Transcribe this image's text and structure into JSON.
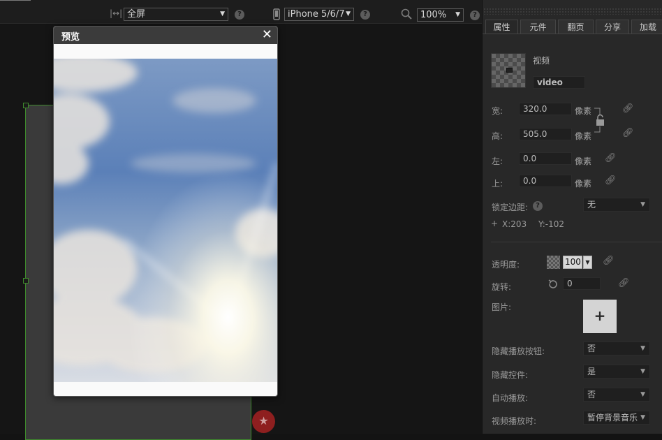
{
  "toolbar": {
    "screen_select": "全屏",
    "device_select": "iPhone 5/6/7",
    "zoom_select": "100%",
    "help": "?"
  },
  "preview": {
    "title": "预览",
    "close": "✕"
  },
  "panel": {
    "tabs": [
      "属性",
      "元件",
      "翻页",
      "分享",
      "加载"
    ],
    "element_type": "视频",
    "element_name": "video",
    "width_label": "宽:",
    "width_value": "320.0",
    "height_label": "高:",
    "height_value": "505.0",
    "left_label": "左:",
    "left_value": "0.0",
    "top_label": "上:",
    "top_value": "0.0",
    "unit": "像素",
    "lock_margin_label": "锁定边距:",
    "lock_margin_value": "无",
    "coord_x": "X:203",
    "coord_y": "Y:-102",
    "opacity_label": "透明度:",
    "opacity_value": "100",
    "rotate_label": "旋转:",
    "rotate_value": "0",
    "image_label": "图片:",
    "image_add": "+",
    "hide_play_label": "隐藏播放按钮:",
    "hide_play_value": "否",
    "hide_controls_label": "隐藏控件:",
    "hide_controls_value": "是",
    "autoplay_label": "自动播放:",
    "autoplay_value": "否",
    "on_play_label": "视频播放时:",
    "on_play_value": "暂停背景音乐"
  },
  "colors": {
    "accent_green": "#3e8a2c",
    "fab_red": "#8e1f1f"
  }
}
